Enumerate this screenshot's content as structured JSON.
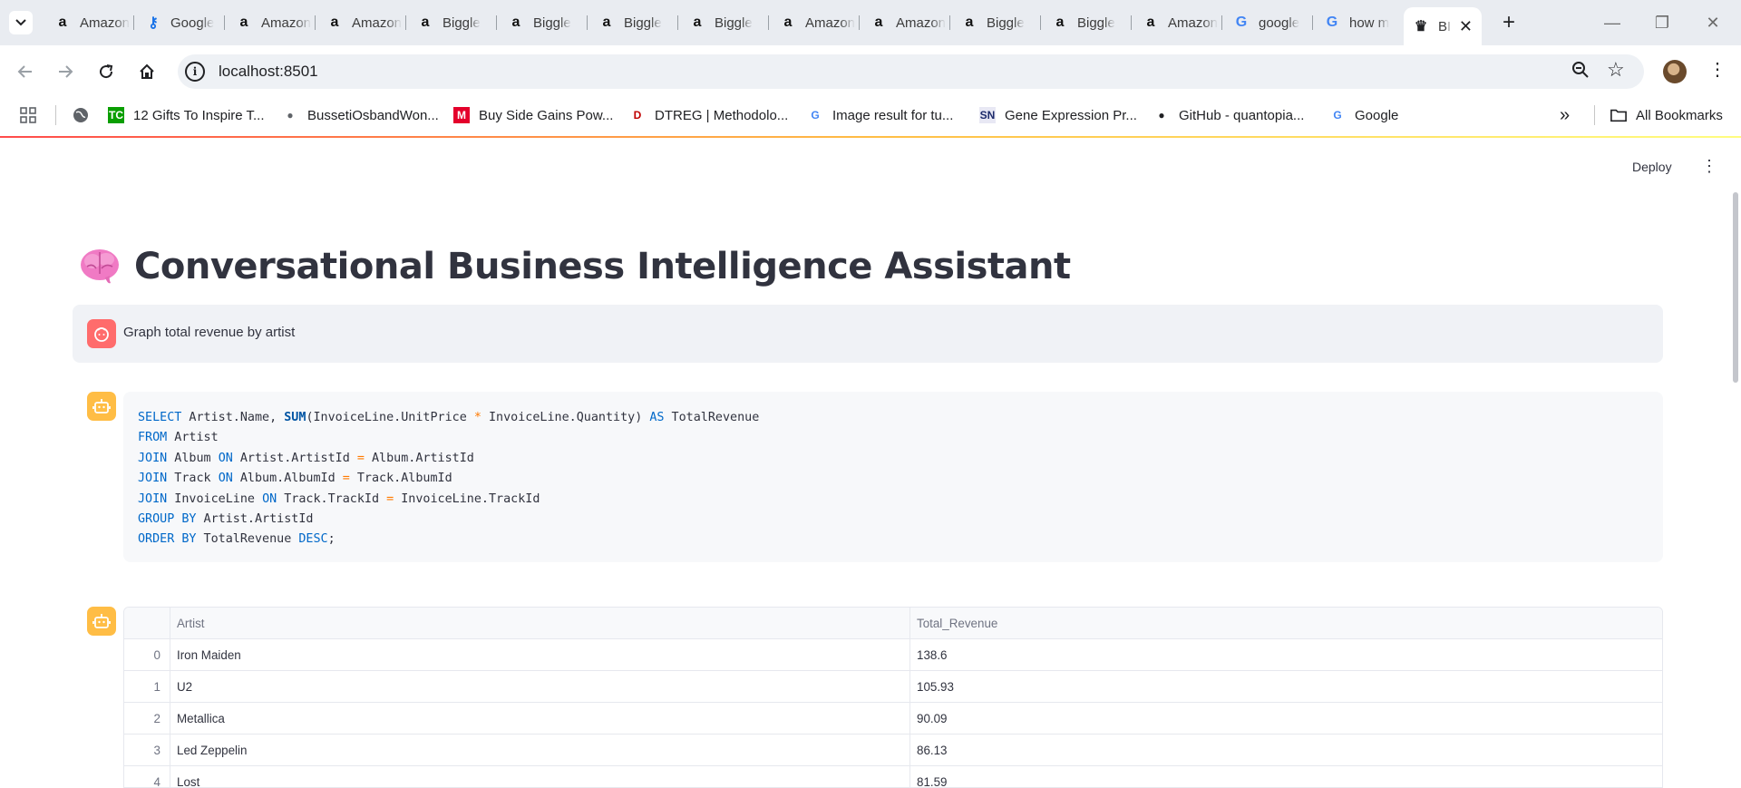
{
  "browser": {
    "tabs": [
      {
        "title": "Amazon",
        "icon": "amazon-icon"
      },
      {
        "title": "Google",
        "icon": "google-key-icon"
      },
      {
        "title": "Amazon",
        "icon": "amazon-icon"
      },
      {
        "title": "Amazon",
        "icon": "amazon-icon"
      },
      {
        "title": "Biggle",
        "icon": "amazon-icon"
      },
      {
        "title": "Biggle",
        "icon": "amazon-icon"
      },
      {
        "title": "Biggle",
        "icon": "amazon-icon"
      },
      {
        "title": "Biggle",
        "icon": "amazon-icon"
      },
      {
        "title": "Amazon",
        "icon": "amazon-icon"
      },
      {
        "title": "Amazon",
        "icon": "amazon-icon"
      },
      {
        "title": "Biggle",
        "icon": "amazon-icon"
      },
      {
        "title": "Biggle",
        "icon": "amazon-icon"
      },
      {
        "title": "Amazon",
        "icon": "amazon-icon"
      },
      {
        "title": "google",
        "icon": "google-icon"
      },
      {
        "title": "how m",
        "icon": "google-icon"
      },
      {
        "title": "BI",
        "icon": "streamlit-icon",
        "active": true
      }
    ],
    "new_tab": "+",
    "url": "localhost:8501",
    "bookmarks": [
      {
        "label": "12 Gifts To Inspire T...",
        "icon": "techcrunch-icon"
      },
      {
        "label": "BussetiOsbandWon...",
        "icon": "globe-icon"
      },
      {
        "label": "Buy Side Gains Pow...",
        "icon": "ms-icon"
      },
      {
        "label": "DTREG | Methodolo...",
        "icon": "dtreg-icon"
      },
      {
        "label": "Image result for tu...",
        "icon": "google-icon"
      },
      {
        "label": "Gene Expression Pr...",
        "icon": "sn-icon"
      },
      {
        "label": "GitHub - quantopia...",
        "icon": "github-icon"
      },
      {
        "label": "Google",
        "icon": "google-icon"
      }
    ],
    "bookmarks_overflow": "»",
    "all_bookmarks": "All Bookmarks",
    "colors": {
      "accent_start": "#ff4b4b",
      "accent_mid": "#ffbd45",
      "accent_end": "#fffd80"
    }
  },
  "app": {
    "deploy_label": "Deploy",
    "title_emoji": "brain-icon",
    "title": "Conversational Business Intelligence Assistant",
    "user_message": "Graph total revenue by artist",
    "sql_lines": [
      [
        {
          "t": "SELECT",
          "c": "kw"
        },
        {
          "t": " Artist.Name, "
        },
        {
          "t": "SUM",
          "c": "fn"
        },
        {
          "t": "(InvoiceLine.UnitPrice "
        },
        {
          "t": "*",
          "c": "op"
        },
        {
          "t": " InvoiceLine.Quantity) "
        },
        {
          "t": "AS",
          "c": "kw"
        },
        {
          "t": " TotalRevenue"
        }
      ],
      [
        {
          "t": "FROM",
          "c": "kw"
        },
        {
          "t": " Artist"
        }
      ],
      [
        {
          "t": "JOIN",
          "c": "kw"
        },
        {
          "t": " Album "
        },
        {
          "t": "ON",
          "c": "kw"
        },
        {
          "t": " Artist.ArtistId "
        },
        {
          "t": "=",
          "c": "op"
        },
        {
          "t": " Album.ArtistId"
        }
      ],
      [
        {
          "t": "JOIN",
          "c": "kw"
        },
        {
          "t": " Track "
        },
        {
          "t": "ON",
          "c": "kw"
        },
        {
          "t": " Album.AlbumId "
        },
        {
          "t": "=",
          "c": "op"
        },
        {
          "t": " Track.AlbumId"
        }
      ],
      [
        {
          "t": "JOIN",
          "c": "kw"
        },
        {
          "t": " InvoiceLine "
        },
        {
          "t": "ON",
          "c": "kw"
        },
        {
          "t": " Track.TrackId "
        },
        {
          "t": "=",
          "c": "op"
        },
        {
          "t": " InvoiceLine.TrackId"
        }
      ],
      [
        {
          "t": "GROUP BY",
          "c": "kw"
        },
        {
          "t": " Artist.ArtistId"
        }
      ],
      [
        {
          "t": "ORDER BY",
          "c": "kw"
        },
        {
          "t": " TotalRevenue "
        },
        {
          "t": "DESC",
          "c": "kw"
        },
        {
          "t": ";"
        }
      ]
    ],
    "table": {
      "columns": [
        "",
        "Artist",
        "Total_Revenue"
      ],
      "rows": [
        [
          "0",
          "Iron Maiden",
          "138.6"
        ],
        [
          "1",
          "U2",
          "105.93"
        ],
        [
          "2",
          "Metallica",
          "90.09"
        ],
        [
          "3",
          "Led Zeppelin",
          "86.13"
        ],
        [
          "4",
          "Lost",
          "81.59"
        ]
      ]
    },
    "colors": {
      "user_avatar": "#ff6c6c",
      "bot_avatar": "#ffbd45",
      "keyword": "#0068c9",
      "operator": "#ff7a00"
    }
  }
}
